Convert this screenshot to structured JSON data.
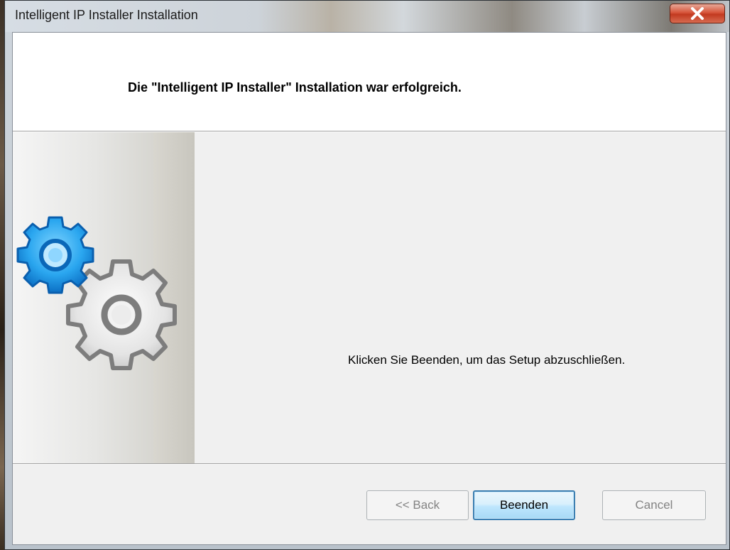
{
  "window": {
    "title": "Intelligent IP Installer Installation",
    "close_label": "X"
  },
  "header": {
    "heading": "Die \"Intelligent IP Installer\" Installation war erfolgreich."
  },
  "content": {
    "message": "Klicken Sie Beenden, um das Setup abzuschließen."
  },
  "buttons": {
    "back": "<< Back",
    "finish": "Beenden",
    "cancel": "Cancel"
  },
  "icons": {
    "close": "close-icon",
    "gears": "gears-icon"
  },
  "colors": {
    "accent_gear": "#1a8fe0",
    "gray_gear": "#8c8c8c",
    "default_button_border": "#3c7fb1"
  }
}
